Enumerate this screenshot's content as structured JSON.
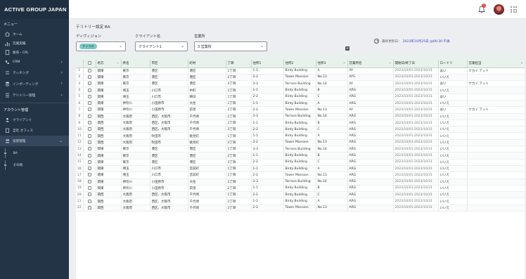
{
  "header": {
    "brand": "ACTIVE GROUP JAPAN",
    "notifications_count": "1"
  },
  "sidebar": {
    "menu_title": "メニュー",
    "items": [
      {
        "label": "ホーム",
        "icon": "home-icon"
      },
      {
        "label": "営業実績",
        "icon": "bar-chart-icon"
      },
      {
        "label": "販売・CRL",
        "icon": "document-icon"
      },
      {
        "label": "CRM",
        "icon": "phone-icon"
      },
      {
        "label": "マッチング",
        "icon": "match-icon"
      },
      {
        "label": "インポーティング",
        "icon": "stack-icon"
      },
      {
        "label": "テリトリー管理",
        "icon": "territory-icon"
      }
    ],
    "account_title": "アカウント管理",
    "account_items": [
      {
        "label": "クライアント",
        "icon": "client-icon"
      },
      {
        "label": "全社 オフィス",
        "icon": "office-icon"
      },
      {
        "label": "役割管理",
        "icon": "roles-icon"
      }
    ],
    "sub_items": [
      {
        "label": "BA"
      },
      {
        "label": "その他"
      }
    ]
  },
  "page": {
    "title": "テリトリー設定 BA",
    "filters": {
      "division_label": "ディヴィジョン",
      "division_value": "チャラみ",
      "client_label": "クライアント名",
      "client_value": "クライアント1",
      "office_label": "営業所",
      "office_value": "3 営業所"
    },
    "last_updated_label": "最終更新日：",
    "last_updated_value": "2023年10月25日 @06:30 午後"
  },
  "table": {
    "columns": [
      "地方",
      "県名",
      "市区",
      "町村",
      "丁目",
      "住所1",
      "住所2",
      "住所3",
      "営業所名",
      "開始日/終了日",
      "ロードリ",
      "営業担当"
    ],
    "rows": [
      [
        "関東",
        "東京",
        "港区",
        "港区",
        "1丁目",
        "1-1",
        "Birdy Building",
        "A",
        "AY",
        "2023/10/01-2023/10/31",
        "はい",
        "ナカイ アット"
      ],
      [
        "関東",
        "東京",
        "港区",
        "港区",
        "2丁目",
        "2-2",
        "Tower Mansion",
        "No.13",
        "AYS",
        "2023/10/01-2023/10/31",
        "いいえ",
        ""
      ],
      [
        "関東",
        "東京",
        "港区",
        "港区",
        "3丁目",
        "3-3",
        "Terrace Building",
        "No.14",
        "AY",
        "2023/10/01-2023/10/31",
        "はい",
        "ナカイ アット"
      ],
      [
        "関東",
        "埼玉",
        "川口市",
        "中町",
        "1丁目",
        "1-1",
        "Birdy Building",
        "B",
        "ARG",
        "2023/10/01-2023/10/31",
        "いいえ",
        ""
      ],
      [
        "関東",
        "埼玉",
        "川口市",
        "朝日",
        "1丁目",
        "2-2",
        "Birdy Building",
        "C",
        "ARG",
        "2023/10/01-2023/10/31",
        "はい",
        ""
      ],
      [
        "関東",
        "神奈川",
        "小田原市",
        "大住",
        "1丁目",
        "1-1",
        "Birdy Building",
        "A",
        "ARG",
        "2023/10/01-2023/10/31",
        "いいえ",
        ""
      ],
      [
        "関東",
        "神奈川",
        "小田原市",
        "荻窪",
        "2丁目",
        "2-2",
        "Tower Mansion",
        "No.13",
        "AY",
        "2023/10/01-2023/10/31",
        "はい",
        "ナカイ アット"
      ],
      [
        "関西",
        "大阪府",
        "西区、大阪市",
        "千代崎",
        "1丁目",
        "3-3",
        "Terrace Building",
        "No.14",
        "ARG",
        "2023/10/01-2023/10/31",
        "いいえ",
        ""
      ],
      [
        "関西",
        "大阪府",
        "西区、大阪市",
        "千代崎",
        "2丁目",
        "1-1",
        "Birdy Building",
        "B",
        "ARG",
        "2023/10/01-2023/10/31",
        "いいえ",
        ""
      ],
      [
        "関西",
        "大阪府",
        "西区、大阪市",
        "千代崎",
        "3丁目",
        "2-2",
        "Birdy Building",
        "C",
        "ARG",
        "2023/10/01-2023/10/31",
        "いいえ",
        ""
      ],
      [
        "関西",
        "大阪府",
        "吹田市",
        "桃見町",
        "1丁目",
        "1-1",
        "Birdy Building",
        "A",
        "ARG",
        "2023/10/01-2023/10/31",
        "いいえ",
        ""
      ],
      [
        "関西",
        "大阪府",
        "吹田市",
        "桃見町",
        "2丁目",
        "2-2",
        "Tower Mansion",
        "No.13",
        "ARG",
        "2023/10/01-2023/10/31",
        "いいえ",
        ""
      ],
      [
        "関東",
        "東京",
        "港区",
        "港区",
        "1丁目",
        "3-3",
        "Terrace Building",
        "No.14",
        "ARG",
        "2023/10/01-2023/10/31",
        "いいえ",
        ""
      ],
      [
        "関東",
        "東京",
        "港区",
        "港区",
        "2丁目",
        "1-1",
        "Birdy Building",
        "B",
        "ARG",
        "2023/10/01-2023/10/31",
        "いいえ",
        ""
      ],
      [
        "関東",
        "東京",
        "港区",
        "港区",
        "3丁目",
        "2-2",
        "Birdy Building",
        "C",
        "ARG",
        "2023/10/01-2023/10/31",
        "いいえ",
        ""
      ],
      [
        "関東",
        "埼玉",
        "川口市",
        "宮前町",
        "1丁目",
        "1-1",
        "Birdy Building",
        "A",
        "ARG",
        "2023/10/01-2023/10/31",
        "いいえ",
        ""
      ],
      [
        "関東",
        "埼玉",
        "川口市",
        "宮前町",
        "1丁目",
        "2-2",
        "Tower Mansion",
        "No.13",
        "ARG",
        "2023/10/01-2023/10/31",
        "いいえ",
        ""
      ],
      [
        "関東",
        "神奈川",
        "小田原市",
        "大住",
        "1丁目",
        "3-3",
        "Terrace Building",
        "No.14",
        "ARG",
        "2023/10/01-2023/10/31",
        "いいえ",
        ""
      ],
      [
        "関東",
        "神奈川",
        "小田原市",
        "荻窪",
        "2丁目",
        "1-1",
        "Birdy Building",
        "B",
        "ARG",
        "2023/10/01-2023/10/31",
        "いいえ",
        ""
      ],
      [
        "関西",
        "大阪府",
        "西区、大阪市",
        "千代崎",
        "1丁目",
        "2-2",
        "Birdy Building",
        "C",
        "ARG",
        "2023/10/01-2023/10/31",
        "いいえ",
        ""
      ],
      [
        "関西",
        "大阪府",
        "西区、大阪市",
        "千代崎",
        "2丁目",
        "1-1",
        "Birdy Building",
        "A",
        "ARG",
        "2023/10/01-2023/10/31",
        "いいえ",
        ""
      ],
      [
        "関西",
        "大阪府",
        "西区、大阪市",
        "千代崎",
        "3丁目",
        "2-2",
        "Tower Mansion",
        "No.13",
        "ARG",
        "2023/10/01-2023/10/31",
        "いいえ",
        ""
      ]
    ]
  },
  "colors": {
    "sidebar_bg": "#243447",
    "brand_bg": "#1f2e40",
    "header_row_bg": "#e7f2ec",
    "chip_bg": "#7ec7c4",
    "timestamp": "#3b46c2",
    "badge": "#e53935"
  }
}
